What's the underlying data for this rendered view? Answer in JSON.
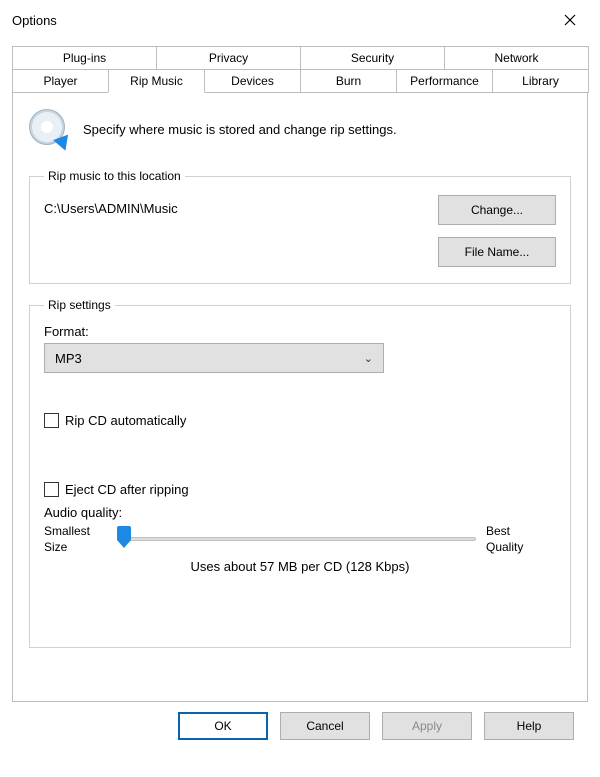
{
  "window": {
    "title": "Options"
  },
  "tabs_top": [
    "Plug-ins",
    "Privacy",
    "Security",
    "Network"
  ],
  "tabs_bottom": [
    "Player",
    "Rip Music",
    "Devices",
    "Burn",
    "Performance",
    "Library"
  ],
  "active_tab": "Rip Music",
  "description": "Specify where music is stored and change rip settings.",
  "location_group": {
    "legend": "Rip music to this location",
    "path": "C:\\Users\\ADMIN\\Music",
    "change_btn": "Change...",
    "filename_btn": "File Name..."
  },
  "rip_group": {
    "legend": "Rip settings",
    "format_label": "Format:",
    "format_value": "MP3",
    "rip_auto_label": "Rip CD automatically",
    "rip_auto_checked": false,
    "eject_label": "Eject CD after ripping",
    "eject_checked": false,
    "audio_quality_label": "Audio quality:",
    "slider_min_label_1": "Smallest",
    "slider_min_label_2": "Size",
    "slider_max_label_1": "Best",
    "slider_max_label_2": "Quality",
    "readout": "Uses about 57 MB per CD (128 Kbps)"
  },
  "footer": {
    "ok": "OK",
    "cancel": "Cancel",
    "apply": "Apply",
    "help": "Help"
  }
}
